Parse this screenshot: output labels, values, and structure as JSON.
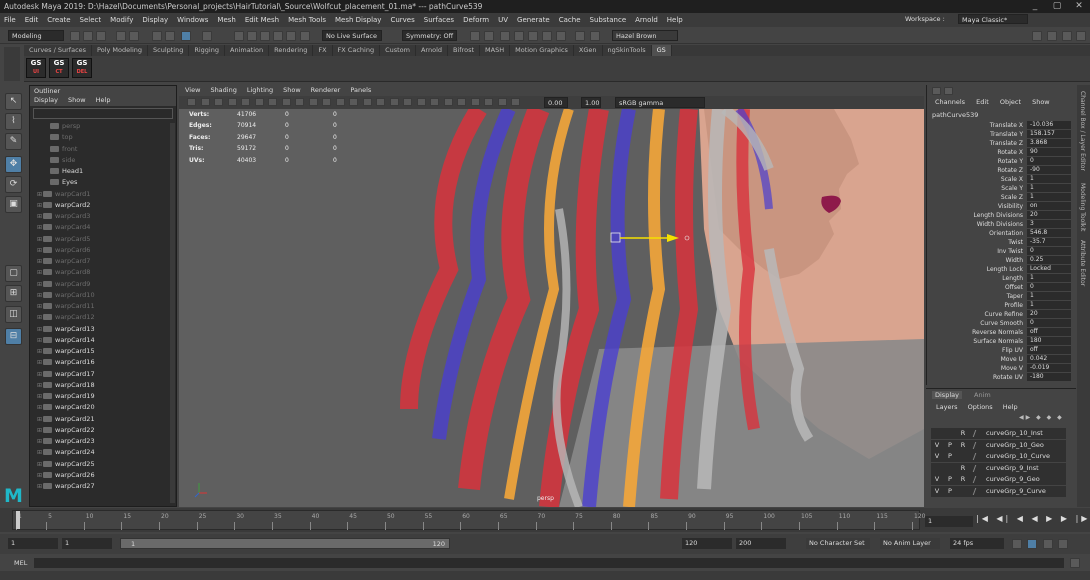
{
  "window": {
    "title": "Autodesk Maya 2019: D:\\Hazel\\Documents\\Personal_projects\\HairTutorial\\_Source\\Wolfcut_placement_01.ma*  ---  pathCurve539",
    "controls": [
      "_",
      "▢",
      "✕"
    ]
  },
  "menubar": [
    "File",
    "Edit",
    "Create",
    "Select",
    "Modify",
    "Display",
    "Windows",
    "Mesh",
    "Edit Mesh",
    "Mesh Tools",
    "Mesh Display",
    "Curves",
    "Surfaces",
    "Deform",
    "UV",
    "Generate",
    "Cache",
    "Substance",
    "Arnold",
    "Help"
  ],
  "workspace": {
    "label": "Workspace :",
    "value": "Maya Classic*"
  },
  "statusline": {
    "mode": "Modeling",
    "live_surface": "No Live Surface",
    "symmetry": "Symmetry: Off",
    "user": "Hazel Brown"
  },
  "shelf": {
    "tabs": [
      "Curves / Surfaces",
      "Poly Modeling",
      "Sculpting",
      "Rigging",
      "Animation",
      "Rendering",
      "FX",
      "FX Caching",
      "Custom",
      "Arnold",
      "Bifrost",
      "MASH",
      "Motion Graphics",
      "XGen",
      "ngSkinTools",
      "GS"
    ],
    "active_tab": "GS",
    "icons": [
      {
        "top": "GS",
        "bottom": "UI"
      },
      {
        "top": "GS",
        "bottom": "CT"
      },
      {
        "top": "GS",
        "bottom": "DEL"
      }
    ]
  },
  "outliner": {
    "title": "Outliner",
    "menu": [
      "Display",
      "Show",
      "Help"
    ],
    "items": [
      {
        "label": "persp",
        "grey": true,
        "sub": true
      },
      {
        "label": "top",
        "grey": true,
        "sub": true
      },
      {
        "label": "front",
        "grey": true,
        "sub": true
      },
      {
        "label": "side",
        "grey": true,
        "sub": true
      },
      {
        "label": "Head1",
        "grey": false,
        "sub": true
      },
      {
        "label": "Eyes",
        "grey": false,
        "sub": true
      },
      {
        "label": "warpCard1",
        "grey": true,
        "sub": false
      },
      {
        "label": "warpCard2",
        "grey": false,
        "sub": false
      },
      {
        "label": "warpCard3",
        "grey": true,
        "sub": false
      },
      {
        "label": "warpCard4",
        "grey": true,
        "sub": false
      },
      {
        "label": "warpCard5",
        "grey": true,
        "sub": false
      },
      {
        "label": "warpCard6",
        "grey": true,
        "sub": false
      },
      {
        "label": "warpCard7",
        "grey": true,
        "sub": false
      },
      {
        "label": "warpCard8",
        "grey": true,
        "sub": false
      },
      {
        "label": "warpCard9",
        "grey": true,
        "sub": false
      },
      {
        "label": "warpCard10",
        "grey": true,
        "sub": false
      },
      {
        "label": "warpCard11",
        "grey": true,
        "sub": false
      },
      {
        "label": "warpCard12",
        "grey": true,
        "sub": false
      },
      {
        "label": "warpCard13",
        "grey": false,
        "sub": false
      },
      {
        "label": "warpCard14",
        "grey": false,
        "sub": false
      },
      {
        "label": "warpCard15",
        "grey": false,
        "sub": false
      },
      {
        "label": "warpCard16",
        "grey": false,
        "sub": false
      },
      {
        "label": "warpCard17",
        "grey": false,
        "sub": false
      },
      {
        "label": "warpCard18",
        "grey": false,
        "sub": false
      },
      {
        "label": "warpCard19",
        "grey": false,
        "sub": false
      },
      {
        "label": "warpCard20",
        "grey": false,
        "sub": false
      },
      {
        "label": "warpCard21",
        "grey": false,
        "sub": false
      },
      {
        "label": "warpCard22",
        "grey": false,
        "sub": false
      },
      {
        "label": "warpCard23",
        "grey": false,
        "sub": false
      },
      {
        "label": "warpCard24",
        "grey": false,
        "sub": false
      },
      {
        "label": "warpCard25",
        "grey": false,
        "sub": false
      },
      {
        "label": "warpCard26",
        "grey": false,
        "sub": false
      },
      {
        "label": "warpCard27",
        "grey": false,
        "sub": false
      }
    ]
  },
  "viewport": {
    "menu": [
      "View",
      "Shading",
      "Lighting",
      "Show",
      "Renderer",
      "Panels"
    ],
    "exposure": "0.00",
    "gamma": "1.00",
    "color_space": "sRGB gamma",
    "camera": "persp",
    "hud": [
      {
        "label": "Verts:",
        "v1": "41706",
        "v2": "0",
        "v3": "0"
      },
      {
        "label": "Edges:",
        "v1": "70914",
        "v2": "0",
        "v3": "0"
      },
      {
        "label": "Faces:",
        "v1": "29647",
        "v2": "0",
        "v3": "0"
      },
      {
        "label": "Tris:",
        "v1": "59172",
        "v2": "0",
        "v3": "0"
      },
      {
        "label": "UVs:",
        "v1": "40403",
        "v2": "0",
        "v3": "0"
      }
    ],
    "colors": {
      "hair_red": "#d8323c",
      "hair_blue": "#4a3fd0",
      "hair_orange": "#f4a63a",
      "hair_grey": "#b8b8b8",
      "skin": "#d9a48f",
      "lip": "#8e1a4a",
      "background": "#5d5d5d",
      "manip_yellow": "#f5e000"
    }
  },
  "channelbox": {
    "menu": [
      "Channels",
      "Edit",
      "Object",
      "Show"
    ],
    "node": "pathCurve539",
    "channels": [
      {
        "label": "Translate X",
        "value": "-10.036"
      },
      {
        "label": "Translate Y",
        "value": "158.157"
      },
      {
        "label": "Translate Z",
        "value": "3.868"
      },
      {
        "label": "Rotate X",
        "value": "90"
      },
      {
        "label": "Rotate Y",
        "value": "0"
      },
      {
        "label": "Rotate Z",
        "value": "-90"
      },
      {
        "label": "Scale X",
        "value": "1"
      },
      {
        "label": "Scale Y",
        "value": "1"
      },
      {
        "label": "Scale Z",
        "value": "1"
      },
      {
        "label": "Visibility",
        "value": "on"
      },
      {
        "label": "Length Divisions",
        "value": "20"
      },
      {
        "label": "Width Divisions",
        "value": "3"
      },
      {
        "label": "Orientation",
        "value": "546.8"
      },
      {
        "label": "Twist",
        "value": "-35.7"
      },
      {
        "label": "Inv Twist",
        "value": "0"
      },
      {
        "label": "Width",
        "value": "0.25"
      },
      {
        "label": "Length Lock",
        "value": "Locked"
      },
      {
        "label": "Length",
        "value": "1"
      },
      {
        "label": "Offset",
        "value": "0"
      },
      {
        "label": "Taper",
        "value": "1"
      },
      {
        "label": "Profile",
        "value": "1"
      },
      {
        "label": "Curve Refine",
        "value": "20"
      },
      {
        "label": "Curve Smooth",
        "value": "0"
      },
      {
        "label": "Reverse Normals",
        "value": "off"
      },
      {
        "label": "Surface Normals",
        "value": "180"
      },
      {
        "label": "Flip UV",
        "value": "off"
      },
      {
        "label": "Move U",
        "value": "0.042"
      },
      {
        "label": "Move V",
        "value": "-0.019"
      },
      {
        "label": "Rotate UV",
        "value": "-180"
      }
    ]
  },
  "sidetabs": [
    "Channel Box / Layer Editor",
    "Modeling Toolkit",
    "Attribute Editor"
  ],
  "layers": {
    "tabs": [
      "Display",
      "Anim"
    ],
    "menu": [
      "Layers",
      "Options",
      "Help"
    ],
    "rows": [
      {
        "v": "",
        "p": "",
        "r": "R",
        "name": "curveGrp_10_Inst"
      },
      {
        "v": "V",
        "p": "P",
        "r": "R",
        "name": "curveGrp_10_Geo"
      },
      {
        "v": "V",
        "p": "P",
        "r": "",
        "name": "curveGrp_10_Curve"
      },
      {
        "v": "",
        "p": "",
        "r": "R",
        "name": "curveGrp_9_Inst"
      },
      {
        "v": "V",
        "p": "P",
        "r": "R",
        "name": "curveGrp_9_Geo"
      },
      {
        "v": "V",
        "p": "P",
        "r": "",
        "name": "curveGrp_9_Curve"
      }
    ]
  },
  "timeline": {
    "start": 1,
    "end": 120,
    "current_frame": "1",
    "tick_labels": [
      "1",
      "5",
      "10",
      "15",
      "20",
      "25",
      "30",
      "35",
      "40",
      "45",
      "50",
      "55",
      "60",
      "65",
      "70",
      "75",
      "80",
      "85",
      "90",
      "95",
      "100",
      "105",
      "110",
      "115",
      "120"
    ],
    "playback": "|◀ ◀| ◀ ◀ ▶ ▶ |▶ ▶|"
  },
  "range": {
    "start": "1",
    "start2": "1",
    "slider_start": "1",
    "slider_end": "120",
    "end": "120",
    "max_end": "200",
    "character_set": "No Character Set",
    "anim_layer": "No Anim Layer",
    "fps": "24 fps"
  },
  "mel": {
    "label": "MEL"
  }
}
